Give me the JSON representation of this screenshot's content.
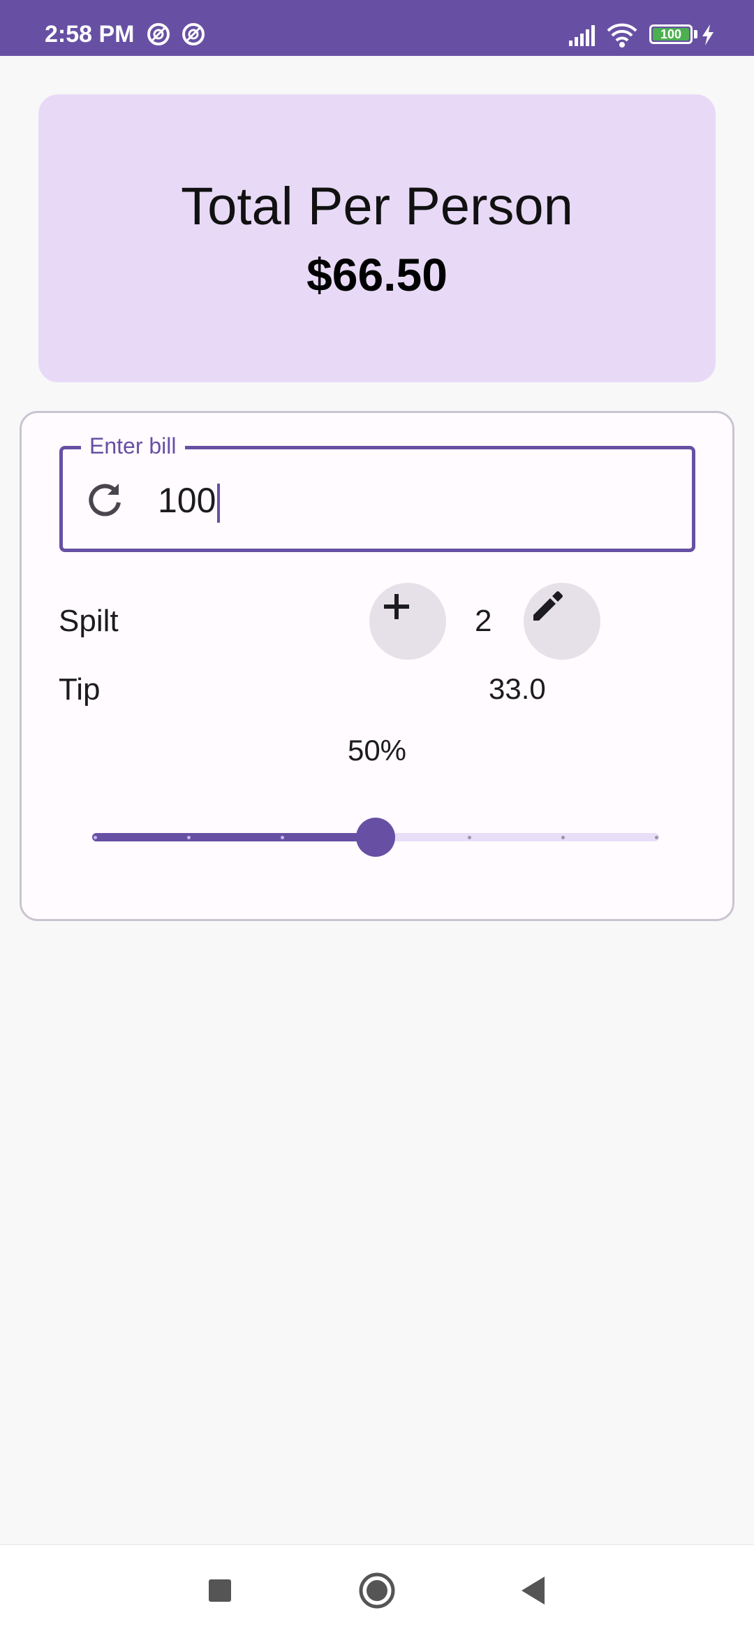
{
  "status_bar": {
    "time": "2:58 PM",
    "battery": "100",
    "icons": [
      "notification-icon",
      "notification-icon",
      "signal-icon",
      "wifi-icon",
      "battery-icon",
      "charging-icon"
    ]
  },
  "total": {
    "label": "Total Per Person",
    "value": "$66.50"
  },
  "bill": {
    "label": "Enter bill",
    "value": "100",
    "leading_icon": "refresh-icon"
  },
  "split": {
    "label": "Spilt",
    "count": "2",
    "increase_icon": "plus-icon",
    "edit_icon": "edit-icon"
  },
  "tip": {
    "label": "Tip",
    "amount": "33.0",
    "percent_label": "50%",
    "slider_fraction": 0.5,
    "slider_steps": 6
  },
  "nav": {
    "buttons": [
      "recents-button",
      "home-button",
      "back-button"
    ]
  },
  "colors": {
    "primary": "#6750a4",
    "card_bg": "#e8daf7",
    "button_bg": "#e6e1e8"
  }
}
